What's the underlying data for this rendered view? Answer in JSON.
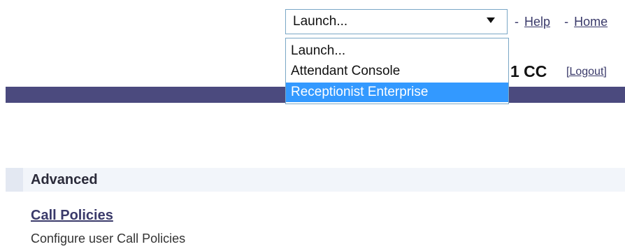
{
  "header": {
    "launch_select": {
      "value": "Launch...",
      "options": [
        "Launch...",
        "Attendant Console",
        "Receptionist Enterprise"
      ],
      "highlighted_option": "Receptionist Enterprise"
    },
    "links": {
      "help_label": "Help",
      "home_label": "Home",
      "separator": "-"
    },
    "user_id_partial": "1 CC",
    "logout_label": "[Logout]",
    "band_color": "#4b4a7e"
  },
  "advanced": {
    "title": "Advanced",
    "items": [
      {
        "label": "Call Policies",
        "description": "Configure user Call Policies"
      }
    ]
  },
  "colors": {
    "accent": "#3399ff",
    "link": "#3a3a6a",
    "section_bg": "#f2f5fa"
  }
}
